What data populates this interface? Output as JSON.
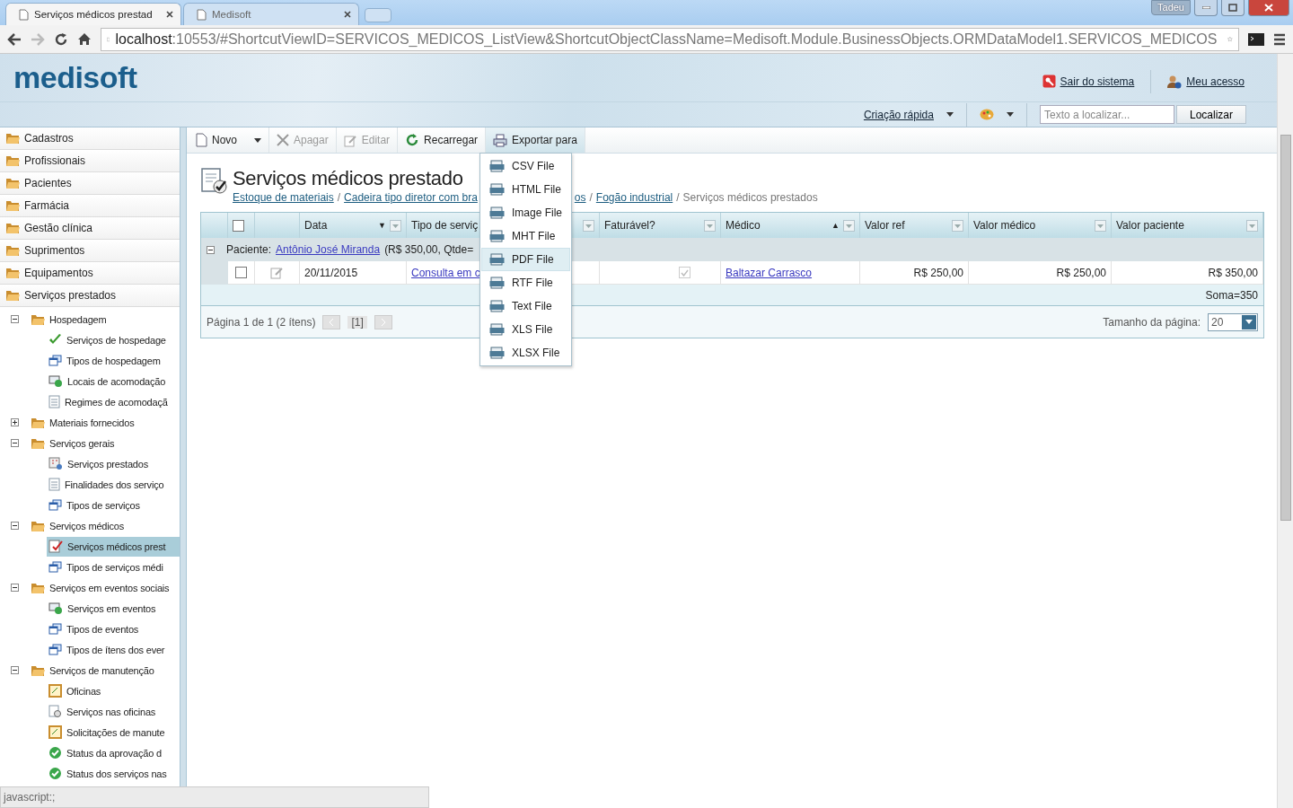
{
  "browser": {
    "tabs": [
      {
        "title": "Serviços médicos prestad",
        "selected": true
      },
      {
        "title": "Medisoft",
        "selected": false
      }
    ],
    "user": "Tadeu",
    "address": {
      "host": "localhost",
      "rest": ":10553/#ShortcutViewID=SERVICOS_MEDICOS_ListView&ShortcutObjectClassName=Medisoft.Module.BusinessObjects.ORMDataModel1.SERVICOS_MEDICOS"
    }
  },
  "header": {
    "logo": "medisoft",
    "links": [
      "Sair do sistema",
      "Meu acesso"
    ],
    "quick_create": "Criação rápida",
    "search": {
      "placeholder": "Texto a localizar..."
    },
    "search_button": "Localizar"
  },
  "sidebar": {
    "groups": [
      "Cadastros",
      "Profissionais",
      "Pacientes",
      "Farmácia",
      "Gestão clínica",
      "Suprimentos",
      "Equipamentos",
      "Serviços prestados"
    ],
    "tree": [
      {
        "label": "Hospedagem",
        "expanded": true,
        "children": [
          {
            "label": "Serviços de hospedage",
            "kind": "check",
            "selected": false
          },
          {
            "label": "Tipos de hospedagem",
            "kind": "stack",
            "selected": false
          },
          {
            "label": "Locais de acomodação",
            "kind": "screen",
            "selected": false
          },
          {
            "label": "Regimes de acomodaçã",
            "kind": "document",
            "selected": false
          }
        ]
      },
      {
        "label": "Materiais fornecidos",
        "expanded": false
      },
      {
        "label": "Serviços gerais",
        "expanded": true,
        "children": [
          {
            "label": "Serviços prestados",
            "kind": "grid",
            "selected": false
          },
          {
            "label": "Finalidades dos serviço",
            "kind": "document",
            "selected": false
          },
          {
            "label": "Tipos de serviços",
            "kind": "stack",
            "selected": false
          }
        ]
      },
      {
        "label": "Serviços médicos",
        "expanded": true,
        "children": [
          {
            "label": "Serviços médicos prest",
            "kind": "task",
            "selected": true
          },
          {
            "label": "Tipos de serviços médi",
            "kind": "stack",
            "selected": false
          }
        ]
      },
      {
        "label": "Serviços em eventos sociais",
        "expanded": true,
        "children": [
          {
            "label": "Serviços em eventos",
            "kind": "screen",
            "selected": false
          },
          {
            "label": "Tipos de eventos",
            "kind": "stack",
            "selected": false
          },
          {
            "label": "Tipos de ítens dos ever",
            "kind": "stack",
            "selected": false
          }
        ]
      },
      {
        "label": "Serviços de manutenção",
        "expanded": true,
        "children": [
          {
            "label": "Oficinas",
            "kind": "frame",
            "selected": false
          },
          {
            "label": "Serviços nas oficinas",
            "kind": "gear",
            "selected": false
          },
          {
            "label": "Solicitações de manute",
            "kind": "frame",
            "selected": false
          },
          {
            "label": "Status da aprovação d",
            "kind": "status",
            "selected": false
          },
          {
            "label": "Status dos serviços nas",
            "kind": "status",
            "selected": false
          }
        ]
      }
    ]
  },
  "toolbar": [
    {
      "label": "Novo",
      "kind": "new",
      "disabled": false,
      "dropdown": true,
      "open": false
    },
    {
      "label": "Apagar",
      "kind": "delete",
      "disabled": true,
      "dropdown": false,
      "open": false
    },
    {
      "label": "Editar",
      "kind": "edit",
      "disabled": true,
      "dropdown": false,
      "open": false
    },
    {
      "label": "Recarregar",
      "kind": "reload",
      "disabled": false,
      "dropdown": false,
      "open": false
    },
    {
      "label": "Exportar para",
      "kind": "export",
      "disabled": false,
      "dropdown": false,
      "open": true
    }
  ],
  "export_menu": [
    {
      "label": "CSV File",
      "highlighted": false
    },
    {
      "label": "HTML File",
      "highlighted": false
    },
    {
      "label": "Image File",
      "highlighted": false
    },
    {
      "label": "MHT File",
      "highlighted": false
    },
    {
      "label": "PDF File",
      "highlighted": true
    },
    {
      "label": "RTF File",
      "highlighted": false
    },
    {
      "label": "Text File",
      "highlighted": false
    },
    {
      "label": "XLS File",
      "highlighted": false
    },
    {
      "label": "XLSX File",
      "highlighted": false
    }
  ],
  "view": {
    "title": "Serviços médicos prestado",
    "separator": "/",
    "breadcrumb": [
      {
        "label": "Estoque de materiais",
        "kind": "link"
      },
      {
        "label": "Cadeira tipo diretor com bra",
        "kind": "link"
      },
      {
        "label": "os",
        "kind": "link"
      },
      {
        "label": "Fogão industrial",
        "kind": "link"
      },
      {
        "label": "Serviços médicos prestados",
        "kind": "current"
      }
    ]
  },
  "table": {
    "select_all": {
      "checked": false
    },
    "columns": [
      {
        "label": "Data",
        "sort": "▼"
      },
      {
        "label": "Tipo de serviç"
      },
      {
        "label": "Faturável?"
      },
      {
        "label": "Médico",
        "sort": "▲"
      },
      {
        "label": "Valor ref"
      },
      {
        "label": "Valor médico"
      },
      {
        "label": "Valor paciente"
      }
    ],
    "group": {
      "expanded": true,
      "label": "Paciente:",
      "patient": "Antônio José Miranda",
      "summary": "(R$ 350,00, Qtde="
    },
    "rows": [
      {
        "checked": false,
        "data": "20/11/2015",
        "tipo": "Consulta em c",
        "faturavel": true,
        "medico": "Baltazar Carrasco",
        "valor_ref": "R$ 250,00",
        "valor_medico": "R$ 250,00",
        "valor_paciente": "R$ 350,00"
      }
    ],
    "total": "Soma=350"
  },
  "pager": {
    "info": "Página 1 de 1 (2 ítens)",
    "current": "[1]",
    "page_size_label": "Tamanho da página:",
    "page_size": "20"
  },
  "status_bar": "javascript:;"
}
